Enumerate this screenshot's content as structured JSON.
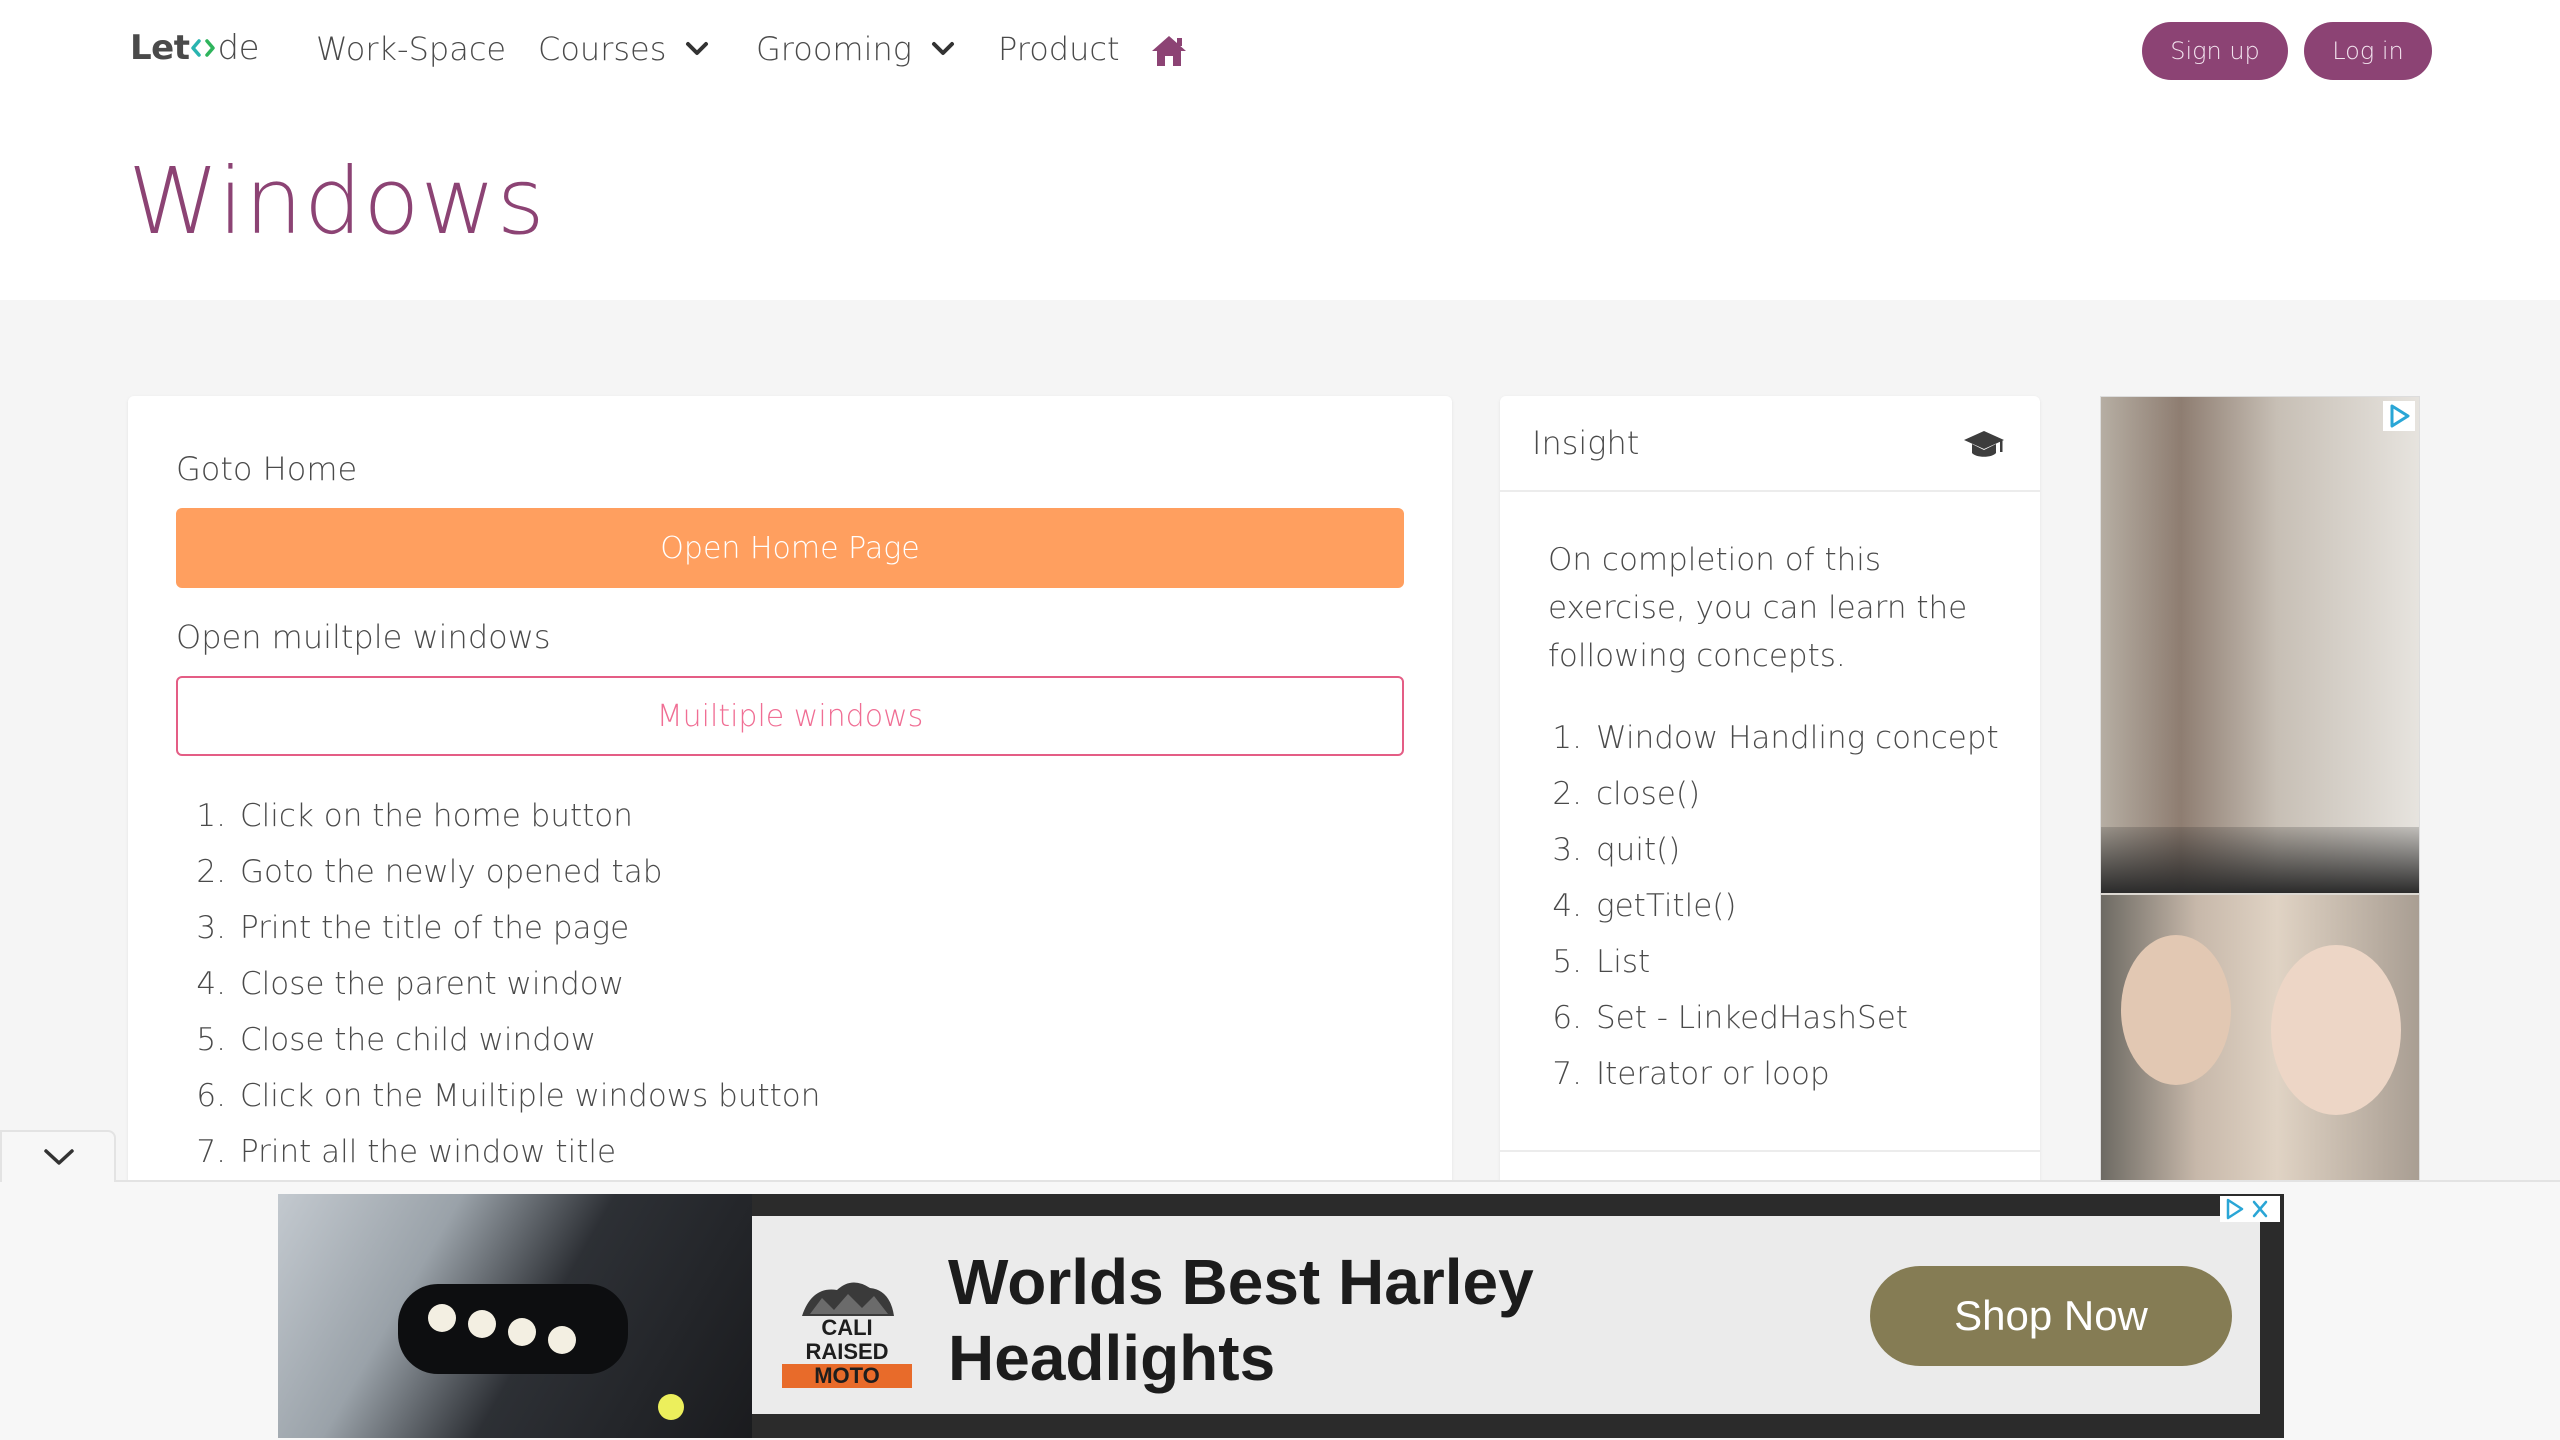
{
  "brand": {
    "left": "Let",
    "right": "de"
  },
  "nav": {
    "workspace": "Work-Space",
    "courses": "Courses",
    "grooming": "Grooming",
    "product": "Product",
    "signup": "Sign up",
    "login": "Log in"
  },
  "page": {
    "title": "Windows"
  },
  "main": {
    "goto_label": "Goto Home",
    "open_home_button": "Open Home Page",
    "multiple_label": "Open muiltple windows",
    "multiple_button": "Muiltiple windows",
    "steps": [
      "Click on the home button",
      "Goto the newly opened tab",
      "Print the title of the page",
      "Close the parent window",
      "Close the child window",
      "Click on the Muiltiple windows button",
      "Print all the window title"
    ]
  },
  "insight": {
    "title": "Insight",
    "text": "On completion of this exercise, you can learn the following concepts.",
    "concepts": [
      "Window Handling concept",
      "close()",
      "quit()",
      "getTitle()",
      "List",
      "Set - LinkedHashSet",
      "Iterator or loop"
    ]
  },
  "ad": {
    "headline_1": "Worlds Best Harley",
    "headline_2": "Headlights",
    "cta": "Shop Now",
    "logo_line_1": "CALI RAISED",
    "logo_line_2": "MOTO"
  },
  "colors": {
    "brand": "#8c4374",
    "orange": "#ff9f5f",
    "pink": "#e45d85",
    "ad_cta": "#857c54"
  }
}
